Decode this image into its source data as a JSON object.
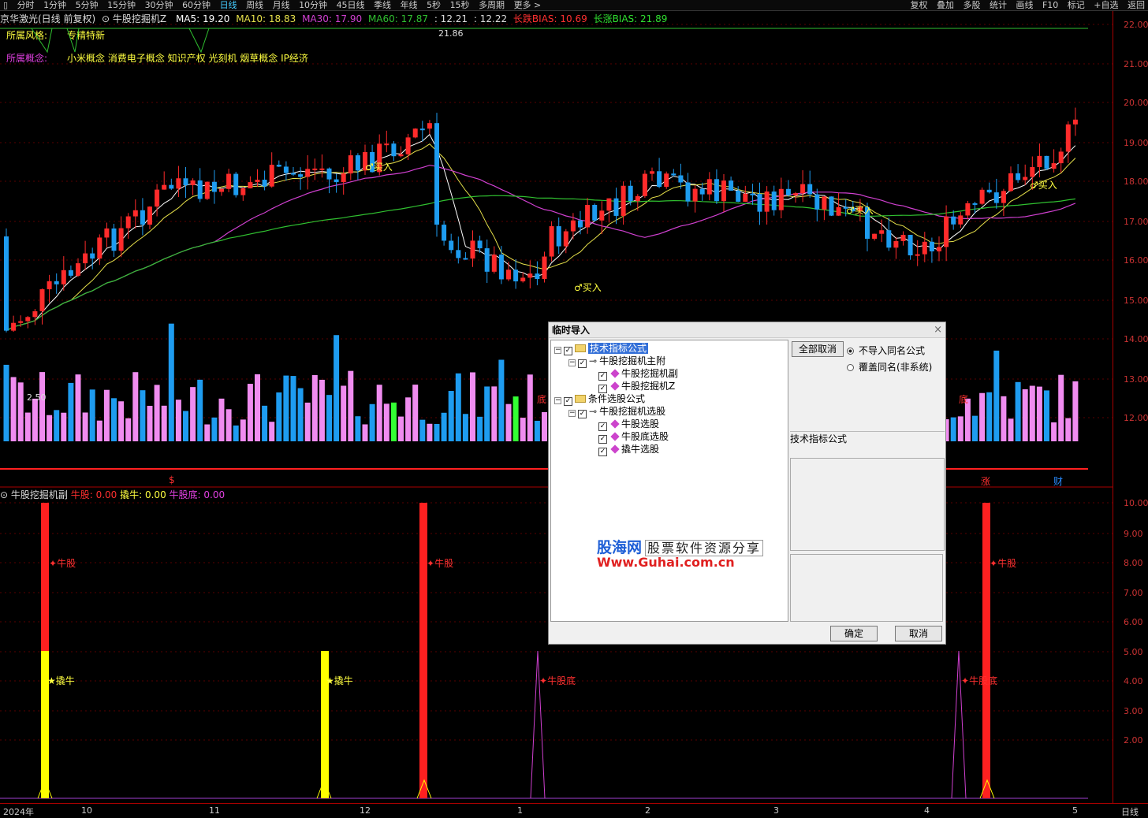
{
  "toolbar": {
    "left": [
      "分时",
      "1分钟",
      "5分钟",
      "15分钟",
      "30分钟",
      "60分钟",
      "日线",
      "周线",
      "月线",
      "10分钟",
      "45日线",
      "季线",
      "年线",
      "5秒",
      "15秒",
      "多周期",
      "更多 >"
    ],
    "selected": "日线",
    "right": [
      "复权",
      "叠加",
      "多股",
      "统计",
      "画线",
      "F10",
      "标记",
      "+自选",
      "返回"
    ]
  },
  "title": {
    "stock": "京华激光(日线 前复权)",
    "indicator": "牛股挖掘机Z",
    "ma5": "MA5: 19.20",
    "ma10": "MA10: 18.83",
    "ma30": "MA30: 17.90",
    "ma60": "MA60: 17.87",
    "v1": ": 12.21",
    "v2": ": 12.22",
    "bias_short": "长跌BIAS: 10.69",
    "bias_long": "长涨BIAS: 21.89"
  },
  "info": {
    "style_label": "所属风格:",
    "style_value": "专精特新",
    "concept_label": "所属概念:",
    "concept_value": "小米概念 消费电子概念 知识产权 光刻机 烟草概念 IP经济"
  },
  "price_axis": [
    "22.00",
    "21.00",
    "20.00",
    "19.00",
    "18.00",
    "17.00",
    "16.00",
    "15.00",
    "14.00",
    "13.00",
    "12.00"
  ],
  "price_marks": {
    "high": "21.86",
    "low": "2.50",
    "buy": [
      "买入",
      "买入",
      "买入",
      "买入",
      "买入"
    ],
    "bottom": [
      "底",
      "底"
    ],
    "events": [
      "$",
      "涨",
      "财"
    ]
  },
  "sub": {
    "name": "牛股挖掘机副",
    "niu_label": "牛股: 0.00",
    "qiao_label": "撬牛: 0.00",
    "di_label": "牛股底: 0.00",
    "axis": [
      "10.00",
      "9.00",
      "8.00",
      "7.00",
      "6.00",
      "5.00",
      "4.00",
      "3.00",
      "2.00"
    ],
    "markers": [
      "牛股",
      "撬牛",
      "撬牛",
      "牛股",
      "牛股底",
      "牛股底",
      "牛股"
    ]
  },
  "xaxis": {
    "labels": [
      "2024年",
      "10",
      "11",
      "12",
      "1",
      "2",
      "3",
      "4",
      "5"
    ],
    "period": "日线"
  },
  "dialog": {
    "title": "临时导入",
    "close": "×",
    "tree": [
      {
        "label": "技术指标公式",
        "level": 0
      },
      {
        "label": "牛股挖掘机主附",
        "level": 1
      },
      {
        "label": "牛股挖掘机副",
        "level": 2
      },
      {
        "label": "牛股挖掘机Z",
        "level": 2
      },
      {
        "label": "条件选股公式",
        "level": 0
      },
      {
        "label": "牛股挖掘机选股",
        "level": 1
      },
      {
        "label": "牛股选股",
        "level": 2
      },
      {
        "label": "牛股底选股",
        "level": 2
      },
      {
        "label": "撬牛选股",
        "level": 2
      }
    ],
    "cancel_all": "全部取消",
    "radio1": "不导入同名公式",
    "radio2": "覆盖同名(非系统)",
    "type_label": "技术指标公式",
    "ok": "确定",
    "cancel": "取消",
    "watermark_site": "股海网",
    "watermark_slogan": "股票软件资源分享",
    "watermark_url": "Www.Guhai.com.cn"
  },
  "colors": {
    "up": "#ff2b2b",
    "down": "#1e9cf0",
    "ma5": "#ffffff",
    "ma10": "#e6e04a",
    "ma30": "#d040d0",
    "ma60": "#30c030",
    "vol_up": "#f08cf0",
    "yellow": "#ffff00",
    "green": "#33ff33"
  }
}
